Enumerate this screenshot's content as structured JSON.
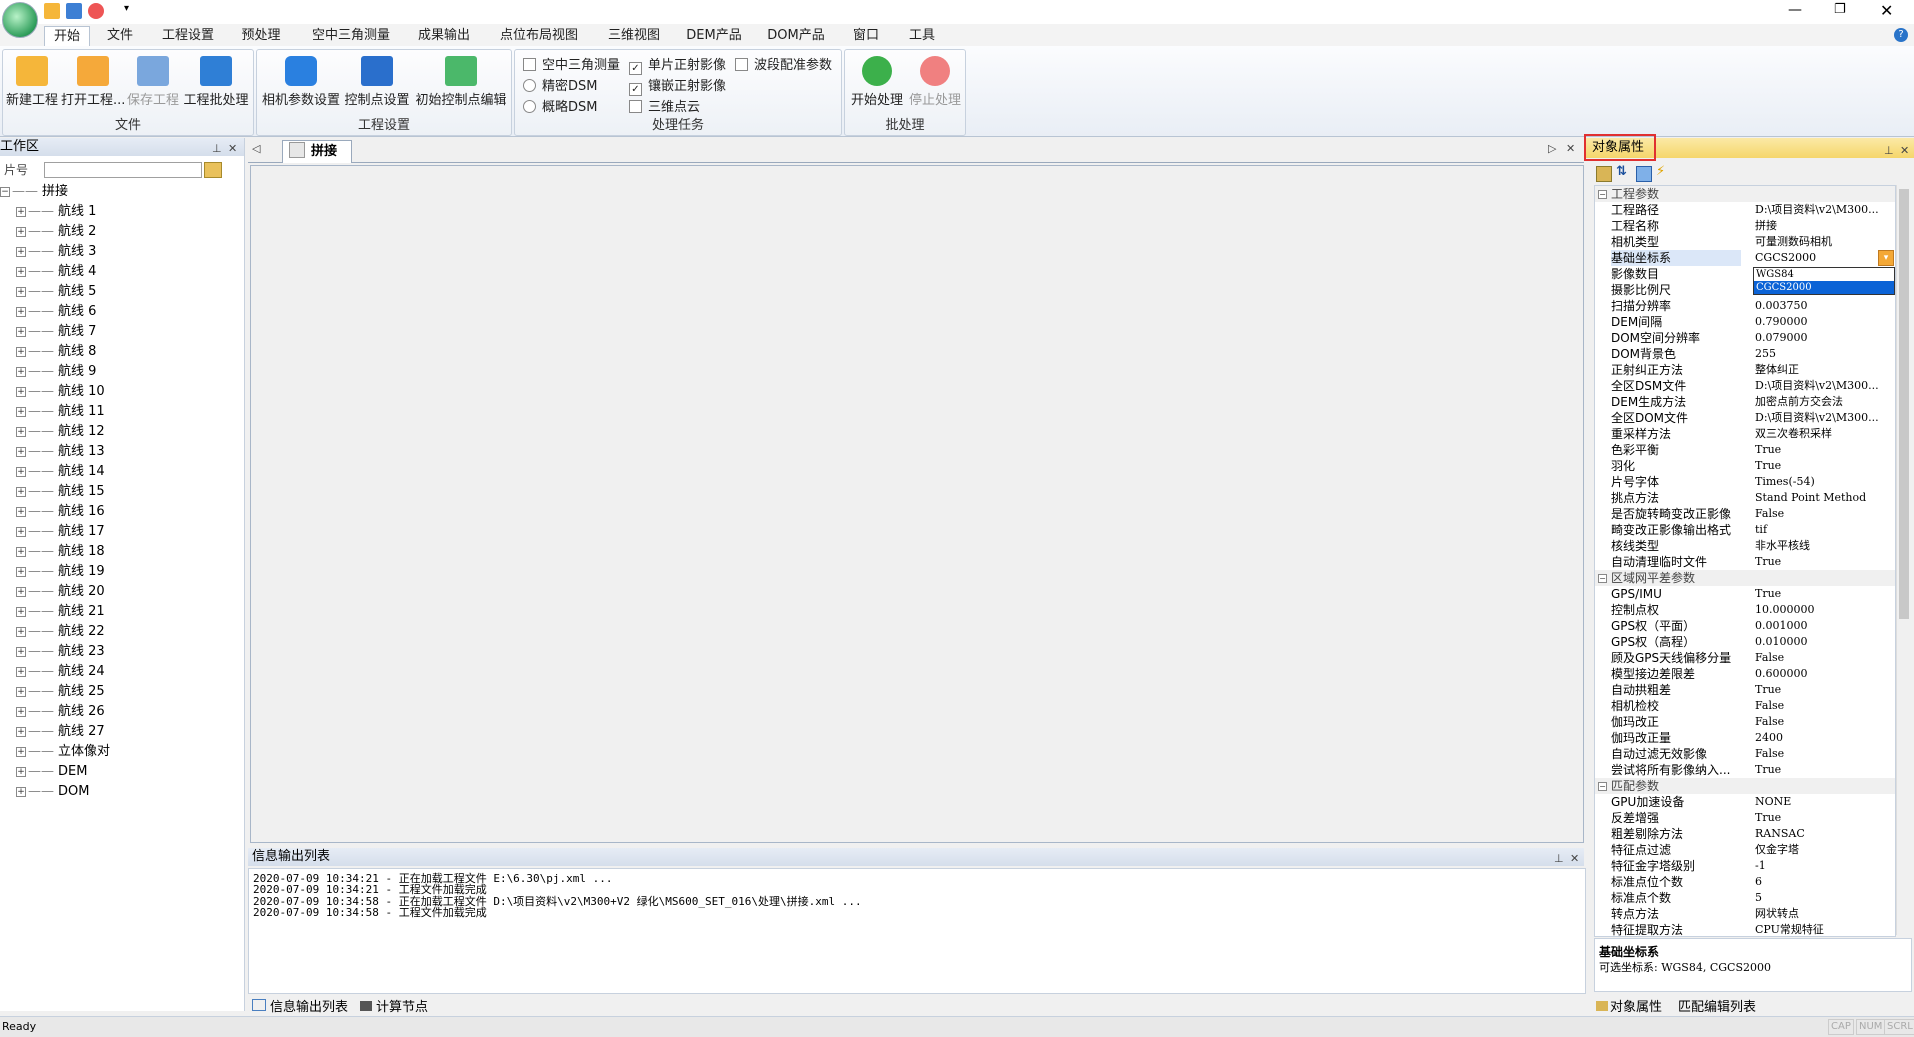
{
  "menu": [
    "开始",
    "文件",
    "工程设置",
    "预处理",
    "空中三角测量",
    "成果输出",
    "点位布局视图",
    "三维视图",
    "DEM产品",
    "DOM产品",
    "窗口",
    "工具"
  ],
  "ribbon": {
    "file_group": "文件",
    "new_project": "新建工程",
    "open_project": "打开工程...",
    "save_project": "保存工程",
    "batch_project": "工程批处理",
    "settings_group": "工程设置",
    "camera_params": "相机参数设置",
    "control_settings": "控制点设置",
    "initial_control": "初始控制点编辑",
    "task_group": "处理任务",
    "opt_aerial": "空中三角测量",
    "opt_single_ortho": "单片正射影像",
    "opt_band_config": "波段配准参数",
    "opt_fine_dsm": "精密DSM",
    "opt_mosaic_ortho": "镶嵌正射影像",
    "opt_rough_dsm": "概略DSM",
    "opt_point_cloud": "三维点云",
    "batch_group": "批处理",
    "start": "开始处理",
    "stop": "停止处理"
  },
  "workspace": {
    "title": "工作区",
    "search_label": "片号",
    "search_value": "",
    "root": "拼接",
    "items": [
      "航线 1",
      "航线 2",
      "航线 3",
      "航线 4",
      "航线 5",
      "航线 6",
      "航线 7",
      "航线 8",
      "航线 9",
      "航线 10",
      "航线 11",
      "航线 12",
      "航线 13",
      "航线 14",
      "航线 15",
      "航线 16",
      "航线 17",
      "航线 18",
      "航线 19",
      "航线 20",
      "航线 21",
      "航线 22",
      "航线 23",
      "航线 24",
      "航线 25",
      "航线 26",
      "航线 27",
      "立体像对",
      "DEM",
      "DOM"
    ]
  },
  "doc": {
    "tab": "拼接"
  },
  "info": {
    "title": "信息输出列表",
    "lines": [
      "2020-07-09 10:34:21 - 正在加载工程文件 E:\\6.30\\pj.xml ...",
      "2020-07-09 10:34:21 - 工程文件加载完成",
      "2020-07-09 10:34:58 - 正在加载工程文件 D:\\项目资料\\v2\\M300+V2 绿化\\MS600_SET_016\\处理\\拼接.xml ...",
      "2020-07-09 10:34:58 - 工程文件加载完成"
    ],
    "tab1": "信息输出列表",
    "tab2": "计算节点"
  },
  "props": {
    "title": "对象属性",
    "rows": [
      {
        "cat": "工程参数"
      },
      {
        "k": "工程路径",
        "v": "D:\\项目资料\\v2\\M300..."
      },
      {
        "k": "工程名称",
        "v": "拼接"
      },
      {
        "k": "相机类型",
        "v": "可量测数码相机"
      },
      {
        "k": "基础坐标系",
        "v": "CGCS2000",
        "sel": true
      },
      {
        "k": "影像数目",
        "v": "WGS84"
      },
      {
        "k": "摄影比例尺",
        "v": "CGCS2000"
      },
      {
        "k": "扫描分辨率",
        "v": "0.003750"
      },
      {
        "k": "DEM间隔",
        "v": "0.790000"
      },
      {
        "k": "DOM空间分辨率",
        "v": "0.079000"
      },
      {
        "k": "DOM背景色",
        "v": "255"
      },
      {
        "k": "正射纠正方法",
        "v": "整体纠正"
      },
      {
        "k": "全区DSM文件",
        "v": "D:\\项目资料\\v2\\M300..."
      },
      {
        "k": "DEM生成方法",
        "v": "加密点前方交会法"
      },
      {
        "k": "全区DOM文件",
        "v": "D:\\项目资料\\v2\\M300..."
      },
      {
        "k": "重采样方法",
        "v": "双三次卷积采样"
      },
      {
        "k": "色彩平衡",
        "v": "True"
      },
      {
        "k": "羽化",
        "v": "True"
      },
      {
        "k": "片号字体",
        "v": "Times(-54)"
      },
      {
        "k": "挑点方法",
        "v": "Stand Point Method"
      },
      {
        "k": "是否旋转畸变改正影像",
        "v": "False"
      },
      {
        "k": "畸变改正影像输出格式",
        "v": "tif"
      },
      {
        "k": "核线类型",
        "v": "非水平核线"
      },
      {
        "k": "自动清理临时文件",
        "v": "True"
      },
      {
        "cat": "区域网平差参数"
      },
      {
        "k": "GPS/IMU",
        "v": "True"
      },
      {
        "k": "控制点权",
        "v": "10.000000"
      },
      {
        "k": "GPS权（平面）",
        "v": "0.001000"
      },
      {
        "k": "GPS权（高程）",
        "v": "0.010000"
      },
      {
        "k": "顾及GPS天线偏移分量",
        "v": "False"
      },
      {
        "k": "模型接边差限差",
        "v": "0.600000"
      },
      {
        "k": "自动拱粗差",
        "v": "True"
      },
      {
        "k": "相机检校",
        "v": "False"
      },
      {
        "k": "伽玛改正",
        "v": "False"
      },
      {
        "k": "伽玛改正量",
        "v": "2400"
      },
      {
        "k": "自动过滤无效影像",
        "v": "False"
      },
      {
        "k": "尝试将所有影像纳入...",
        "v": "True"
      },
      {
        "cat": "匹配参数"
      },
      {
        "k": "GPU加速设备",
        "v": "NONE"
      },
      {
        "k": "反差增强",
        "v": "True"
      },
      {
        "k": "粗差剔除方法",
        "v": "RANSAC"
      },
      {
        "k": "特征点过滤",
        "v": "仅金字塔"
      },
      {
        "k": "特征金字塔级别",
        "v": "-1"
      },
      {
        "k": "标准点位个数",
        "v": "6"
      },
      {
        "k": "标准点个数",
        "v": "5"
      },
      {
        "k": "转点方法",
        "v": "网状转点"
      },
      {
        "k": "特征提取方法",
        "v": "CPU常规特征"
      }
    ],
    "dropdown": [
      "WGS84",
      "CGCS2000"
    ],
    "desc_title": "基础坐标系",
    "desc_text": "可选坐标系: WGS84, CGCS2000",
    "tab1": "对象属性",
    "tab2": "匹配编辑列表"
  },
  "status": {
    "text": "Ready",
    "cap": "CAP",
    "num": "NUM",
    "scrl": "SCRL"
  },
  "colors": {
    "accent": "#2a74c9",
    "highlight": "#e03030",
    "selected": "#0b63d6"
  }
}
